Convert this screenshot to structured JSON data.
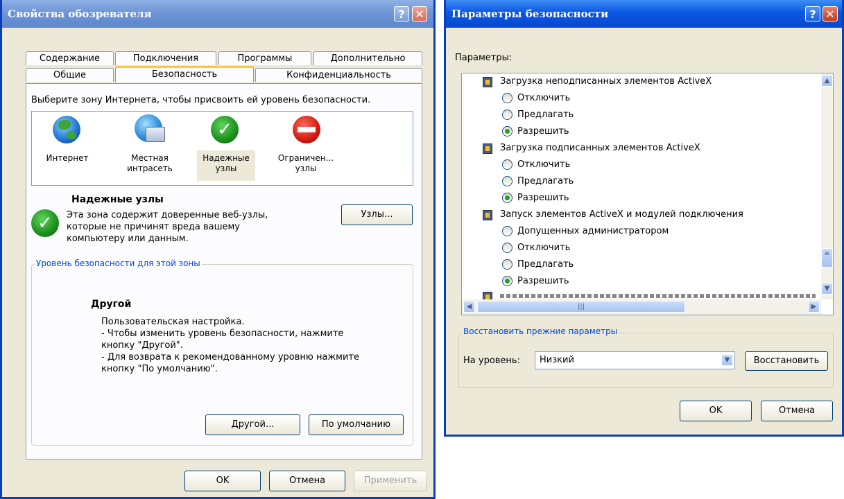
{
  "left_dialog": {
    "title": "Свойства обозревателя",
    "tabs_row1": [
      "Содержание",
      "Подключения",
      "Программы",
      "Дополнительно"
    ],
    "tabs_row2": [
      "Общие",
      "Безопасность",
      "Конфиденциальность"
    ],
    "instruction": "Выберите зону Интернета, чтобы присвоить ей уровень безопасности.",
    "zones": [
      {
        "label": "Интернет",
        "icon": "globe-icon"
      },
      {
        "label": "Местная интрасеть",
        "icon": "intranet-icon"
      },
      {
        "label": "Надежные узлы",
        "icon": "trusted-check-icon",
        "selected": true
      },
      {
        "label": "Ограничен... узлы",
        "icon": "restricted-icon"
      }
    ],
    "zone_info": {
      "title": "Надежные узлы",
      "description": "Эта зона содержит доверенные веб-узлы, которые не причинят вреда вашему компьютеру или данным.",
      "sites_button": "Узлы..."
    },
    "level_group": {
      "label": "Уровень безопасности для этой зоны",
      "level_name": "Другой",
      "line1": "Пользовательская настройка.",
      "line2": "- Чтобы изменить уровень безопасности, нажмите кнопку \"Другой\".",
      "line3": "- Для возврата к рекомендованному уровню нажмите кнопку \"По умолчанию\".",
      "custom_button": "Другой...",
      "default_button": "По умолчанию"
    },
    "buttons": {
      "ok": "OK",
      "cancel": "Отмена",
      "apply": "Применить"
    }
  },
  "right_dialog": {
    "title": "Параметры безопасности",
    "settings_label": "Параметры:",
    "groups": [
      {
        "title": "Загрузка неподписанных элементов ActiveX",
        "options": [
          "Отключить",
          "Предлагать",
          "Разрешить"
        ],
        "selected": 2
      },
      {
        "title": "Загрузка подписанных элементов ActiveX",
        "options": [
          "Отключить",
          "Предлагать",
          "Разрешить"
        ],
        "selected": 2
      },
      {
        "title": "Запуск элементов ActiveX и модулей подключения",
        "options": [
          "Допущенных администратором",
          "Отключить",
          "Предлагать",
          "Разрешить"
        ],
        "selected": 3
      }
    ],
    "reset_group": {
      "label": "Восстановить прежние параметры",
      "level_label": "На уровень:",
      "level_value": "Низкий",
      "reset_button": "Восстановить"
    },
    "buttons": {
      "ok": "OK",
      "cancel": "Отмена"
    }
  },
  "colors": {
    "title_active": "#0a57e3",
    "title_inactive": "#6e95d6",
    "group_label": "#0046d5",
    "window_bg": "#ece9d8"
  }
}
